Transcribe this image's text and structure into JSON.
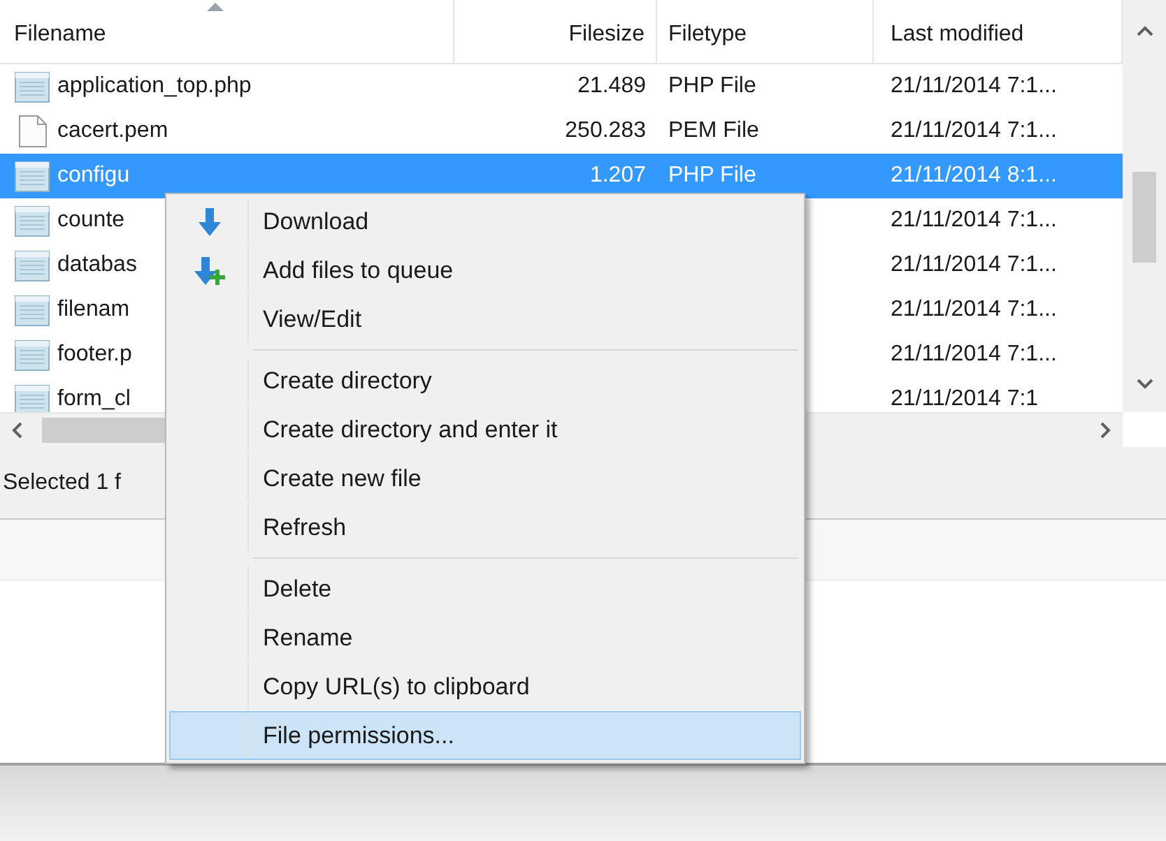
{
  "file_list": {
    "columns": [
      {
        "label": "Filename",
        "sort_ascending": true
      },
      {
        "label": "Filesize",
        "sort_ascending": false
      },
      {
        "label": "Filetype",
        "sort_ascending": false
      },
      {
        "label": "Last modified",
        "sort_ascending": false
      }
    ],
    "rows": [
      {
        "kind": "script",
        "name": "application_top.php",
        "size": "21.489",
        "type": "PHP File",
        "modified": "21/11/2014 7:1...",
        "selected": false
      },
      {
        "kind": "plain",
        "name": "cacert.pem",
        "size": "250.283",
        "type": "PEM File",
        "modified": "21/11/2014 7:1...",
        "selected": false
      },
      {
        "kind": "script",
        "name": "configu",
        "size": "1.207",
        "type": "PHP File",
        "modified": "21/11/2014 8:1...",
        "selected": true
      },
      {
        "kind": "script",
        "name": "counte",
        "modified": "21/11/2014 7:1...",
        "selected": false
      },
      {
        "kind": "script",
        "name": "databas",
        "modified": "21/11/2014 7:1...",
        "selected": false
      },
      {
        "kind": "script",
        "name": "filenam",
        "modified": "21/11/2014 7:1...",
        "selected": false
      },
      {
        "kind": "script",
        "name": "footer.p",
        "modified": "21/11/2014 7:1...",
        "selected": false
      },
      {
        "kind": "script",
        "name": "form_cl",
        "modified": "21/11/2014 7:1",
        "selected": false
      }
    ]
  },
  "status_bar": {
    "text": "Selected 1 f"
  },
  "context_menu": {
    "groups": [
      [
        {
          "label": "Download",
          "kind": "download",
          "selected": false
        },
        {
          "label": "Add files to queue",
          "kind": "queue",
          "selected": false
        },
        {
          "label": "View/Edit",
          "selected": false
        }
      ],
      [
        {
          "label": "Create directory",
          "selected": false
        },
        {
          "label": "Create directory and enter it",
          "selected": false
        },
        {
          "label": "Create new file",
          "selected": false
        },
        {
          "label": "Refresh",
          "selected": false
        }
      ],
      [
        {
          "label": "Delete",
          "selected": false
        },
        {
          "label": "Rename",
          "selected": false
        },
        {
          "label": "Copy URL(s) to clipboard",
          "selected": false
        },
        {
          "label": "File permissions...",
          "selected": true
        }
      ]
    ]
  }
}
